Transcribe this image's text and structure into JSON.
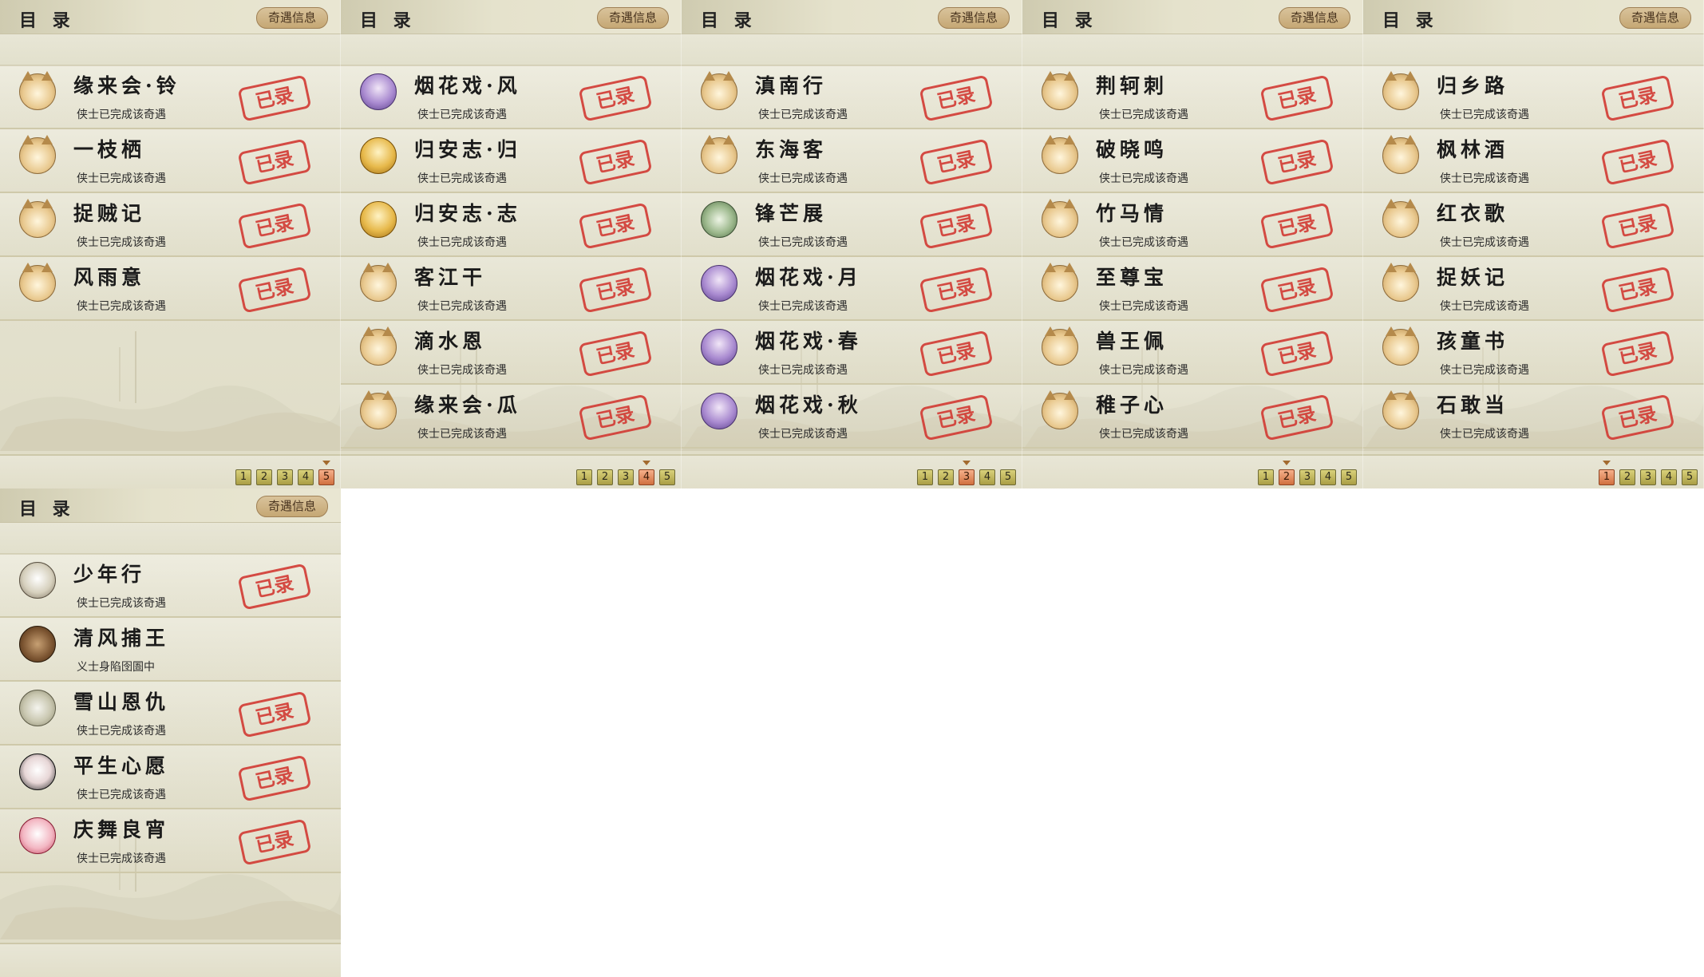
{
  "common": {
    "header_title": "目 录",
    "info_button": "奇遇信息",
    "stamp_text": "已录",
    "pages": [
      "1",
      "2",
      "3",
      "4",
      "5"
    ]
  },
  "panels": [
    {
      "active_page": 5,
      "entries": [
        {
          "name": "缘来会·铃",
          "status": "侠士已完成该奇遇",
          "icon": "cat",
          "stamped": true
        },
        {
          "name": "一枝栖",
          "status": "侠士已完成该奇遇",
          "icon": "cat",
          "stamped": true
        },
        {
          "name": "捉贼记",
          "status": "侠士已完成该奇遇",
          "icon": "cat",
          "stamped": true
        },
        {
          "name": "风雨意",
          "status": "侠士已完成该奇遇",
          "icon": "cat",
          "stamped": true
        }
      ]
    },
    {
      "active_page": 4,
      "entries": [
        {
          "name": "烟花戏·风",
          "status": "侠士已完成该奇遇",
          "icon": "lady",
          "stamped": true
        },
        {
          "name": "归安志·归",
          "status": "侠士已完成该奇遇",
          "icon": "buddha",
          "stamped": true
        },
        {
          "name": "归安志·志",
          "status": "侠士已完成该奇遇",
          "icon": "buddha",
          "stamped": true
        },
        {
          "name": "客江干",
          "status": "侠士已完成该奇遇",
          "icon": "cat",
          "stamped": true
        },
        {
          "name": "滴水恩",
          "status": "侠士已完成该奇遇",
          "icon": "cat",
          "stamped": true
        },
        {
          "name": "缘来会·瓜",
          "status": "侠士已完成该奇遇",
          "icon": "cat",
          "stamped": true
        }
      ]
    },
    {
      "active_page": 3,
      "entries": [
        {
          "name": "滇南行",
          "status": "侠士已完成该奇遇",
          "icon": "cat",
          "stamped": true
        },
        {
          "name": "东海客",
          "status": "侠士已完成该奇遇",
          "icon": "cat",
          "stamped": true
        },
        {
          "name": "锋芒展",
          "status": "侠士已完成该奇遇",
          "icon": "jade",
          "stamped": true
        },
        {
          "name": "烟花戏·月",
          "status": "侠士已完成该奇遇",
          "icon": "lady",
          "stamped": true
        },
        {
          "name": "烟花戏·春",
          "status": "侠士已完成该奇遇",
          "icon": "lady",
          "stamped": true
        },
        {
          "name": "烟花戏·秋",
          "status": "侠士已完成该奇遇",
          "icon": "lady",
          "stamped": true
        }
      ]
    },
    {
      "active_page": 2,
      "entries": [
        {
          "name": "荆轲刺",
          "status": "侠士已完成该奇遇",
          "icon": "cat",
          "stamped": true
        },
        {
          "name": "破晓鸣",
          "status": "侠士已完成该奇遇",
          "icon": "cat",
          "stamped": true
        },
        {
          "name": "竹马情",
          "status": "侠士已完成该奇遇",
          "icon": "cat",
          "stamped": true
        },
        {
          "name": "至尊宝",
          "status": "侠士已完成该奇遇",
          "icon": "cat",
          "stamped": true
        },
        {
          "name": "兽王佩",
          "status": "侠士已完成该奇遇",
          "icon": "cat",
          "stamped": true
        },
        {
          "name": "稚子心",
          "status": "侠士已完成该奇遇",
          "icon": "cat",
          "stamped": true
        }
      ]
    },
    {
      "active_page": 1,
      "entries": [
        {
          "name": "归乡路",
          "status": "侠士已完成该奇遇",
          "icon": "cat",
          "stamped": true
        },
        {
          "name": "枫林酒",
          "status": "侠士已完成该奇遇",
          "icon": "cat",
          "stamped": true
        },
        {
          "name": "红衣歌",
          "status": "侠士已完成该奇遇",
          "icon": "cat",
          "stamped": true
        },
        {
          "name": "捉妖记",
          "status": "侠士已完成该奇遇",
          "icon": "cat",
          "stamped": true
        },
        {
          "name": "孩童书",
          "status": "侠士已完成该奇遇",
          "icon": "cat",
          "stamped": true
        },
        {
          "name": "石敢当",
          "status": "侠士已完成该奇遇",
          "icon": "cat",
          "stamped": true
        }
      ]
    },
    {
      "active_page": null,
      "entries": [
        {
          "name": "少年行",
          "status": "侠士已完成该奇遇",
          "icon": "hat",
          "stamped": true
        },
        {
          "name": "清风捕王",
          "status": "义士身陷囹圄中",
          "icon": "beast",
          "stamped": false
        },
        {
          "name": "雪山恩仇",
          "status": "侠士已完成该奇遇",
          "icon": "sword",
          "stamped": true
        },
        {
          "name": "平生心愿",
          "status": "侠士已完成该奇遇",
          "icon": "clown",
          "stamped": true
        },
        {
          "name": "庆舞良宵",
          "status": "侠士已完成该奇遇",
          "icon": "pink",
          "stamped": true
        }
      ]
    }
  ]
}
